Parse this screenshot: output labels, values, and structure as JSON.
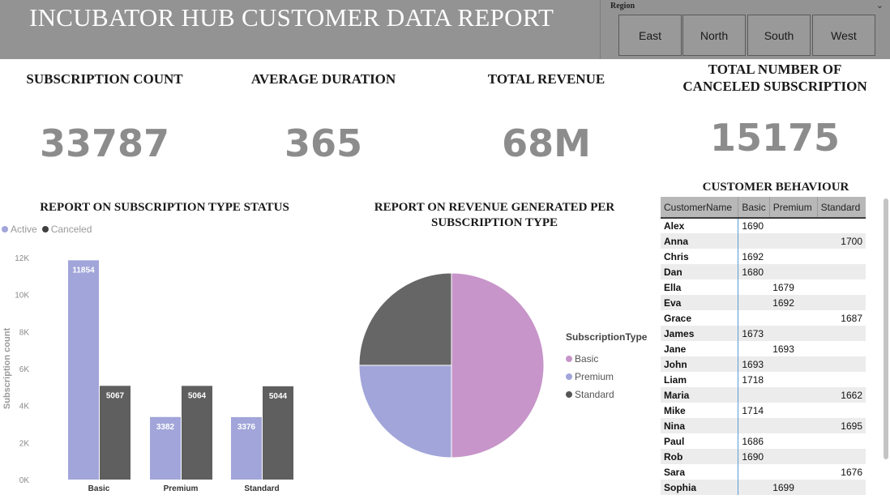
{
  "header": {
    "title": "INCUBATOR HUB CUSTOMER DATA REPORT",
    "color": "#939393"
  },
  "region_slicer": {
    "label": "Region",
    "options": [
      "East",
      "North",
      "South",
      "West"
    ]
  },
  "kpis": [
    {
      "label": "SUBSCRIPTION COUNT",
      "value": "33787"
    },
    {
      "label": "AVERAGE DURATION",
      "value": "365"
    },
    {
      "label": "TOTAL REVENUE",
      "value": "68M"
    },
    {
      "label_line1": "TOTAL NUMBER OF",
      "label_line2": "CANCELED SUBSCRIPTION",
      "value": "15175"
    }
  ],
  "status_report": {
    "title": "REPORT ON SUBSCRIPTION TYPE STATUS",
    "legend": [
      "Active",
      "Canceled"
    ]
  },
  "revenue_report": {
    "title_line1": "REPORT ON REVENUE GENERATED PER",
    "title_line2": "SUBSCRIPTION TYPE",
    "legend_title": "SubscriptionType",
    "legend": [
      "Basic",
      "Premium",
      "Standard"
    ]
  },
  "chart_data": [
    {
      "type": "bar",
      "title": "REPORT ON SUBSCRIPTION TYPE STATUS",
      "categories": [
        "Basic",
        "Premium",
        "Standard"
      ],
      "series": [
        {
          "name": "Active",
          "values": [
            11854,
            3382,
            3376
          ],
          "color": "#a1a5d9"
        },
        {
          "name": "Canceled",
          "values": [
            5067,
            5064,
            5044
          ],
          "color": "#5f5f5f"
        }
      ],
      "ylabel": "Subscription count",
      "xlabel": "",
      "ylim": [
        0,
        12000
      ],
      "yticks": [
        "0K",
        "2K",
        "4K",
        "6K",
        "8K",
        "10K",
        "12K"
      ],
      "legend_position": "top-left",
      "grid": false
    },
    {
      "type": "pie",
      "title": "REPORT ON REVENUE GENERATED PER SUBSCRIPTION TYPE",
      "categories": [
        "Basic",
        "Premium",
        "Standard"
      ],
      "values": [
        50,
        25,
        25
      ],
      "colors": [
        "#c795c9",
        "#a1a5d9",
        "#666666"
      ],
      "legend_position": "right"
    }
  ],
  "customer_behaviour": {
    "title": "CUSTOMER BEHAVIOUR",
    "columns": [
      "CustomerName",
      "Basic",
      "Premium",
      "Standard"
    ],
    "rows": [
      [
        "Alex",
        "1690",
        "",
        ""
      ],
      [
        "Anna",
        "",
        "",
        "1700"
      ],
      [
        "Chris",
        "1692",
        "",
        ""
      ],
      [
        "Dan",
        "1680",
        "",
        ""
      ],
      [
        "Ella",
        "",
        "1679",
        ""
      ],
      [
        "Eva",
        "",
        "1692",
        ""
      ],
      [
        "Grace",
        "",
        "",
        "1687"
      ],
      [
        "James",
        "1673",
        "",
        ""
      ],
      [
        "Jane",
        "",
        "1693",
        ""
      ],
      [
        "John",
        "1693",
        "",
        ""
      ],
      [
        "Liam",
        "1718",
        "",
        ""
      ],
      [
        "Maria",
        "",
        "",
        "1662"
      ],
      [
        "Mike",
        "1714",
        "",
        ""
      ],
      [
        "Nina",
        "",
        "",
        "1695"
      ],
      [
        "Paul",
        "1686",
        "",
        ""
      ],
      [
        "Rob",
        "1690",
        "",
        ""
      ],
      [
        "Sara",
        "",
        "",
        "1676"
      ],
      [
        "Sophia",
        "",
        "1699",
        ""
      ]
    ]
  }
}
